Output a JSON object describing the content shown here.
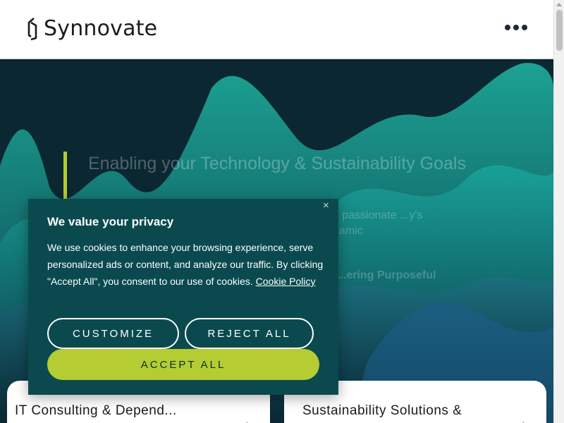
{
  "header": {
    "brand": "Synnovate",
    "logo_icon": "synnovate-logo-mark",
    "menu_icon": "ellipsis-menu-icon"
  },
  "hero": {
    "title": "Enabling your Technology & Sustainability Goals",
    "description": "...ts passionate ...y's dynamic",
    "link": "...ering Purposeful"
  },
  "cards": [
    {
      "title": "IT Consulting & Depend...",
      "arrow_icon": "arrow-right-icon"
    },
    {
      "title": "Sustainability Solutions & Depend...",
      "arrow_icon": "arrow-right-icon"
    }
  ],
  "cookie": {
    "title": "We value your privacy",
    "text": "We use cookies to enhance your browsing experience, serve personalized ads or content, and analyze our traffic. By clicking \"Accept All\", you consent to our use of cookies.",
    "policy_link": "Cookie Policy",
    "close_icon": "close-icon",
    "close_glyph": "×",
    "customize_label": "CUSTOMIZE",
    "reject_label": "REJECT ALL",
    "accept_label": "ACCEPT ALL"
  },
  "colors": {
    "accent": "#b5cc32",
    "modal_bg": "#0a4a4f",
    "hero_bg": "#092631"
  }
}
